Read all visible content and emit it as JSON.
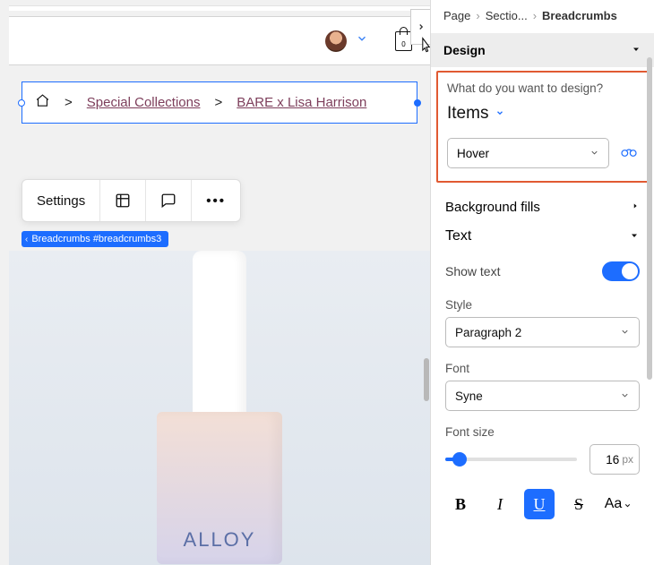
{
  "canvas": {
    "bag_count": "0",
    "breadcrumb": {
      "link1": "Special Collections",
      "link2": "BARE x Lisa Harrison"
    },
    "product_brand": "ALLOY",
    "toolbar": {
      "settings": "Settings"
    },
    "element_tag": "Breadcrumbs #breadcrumbs3"
  },
  "panel": {
    "crumbs": {
      "a": "Page",
      "b": "Sectio...",
      "c": "Breadcrumbs"
    },
    "design_label": "Design",
    "question": "What do you want to design?",
    "target": "Items",
    "state_select": "Hover",
    "bg_fills": "Background fills",
    "text_label": "Text",
    "show_text": "Show text",
    "style_label": "Style",
    "style_value": "Paragraph 2",
    "font_label": "Font",
    "font_value": "Syne",
    "fontsize_label": "Font size",
    "fontsize_value": "16",
    "fontsize_unit": "px",
    "fmt": {
      "b": "B",
      "i": "I",
      "u": "U",
      "s": "S",
      "aa": "Aa"
    }
  }
}
